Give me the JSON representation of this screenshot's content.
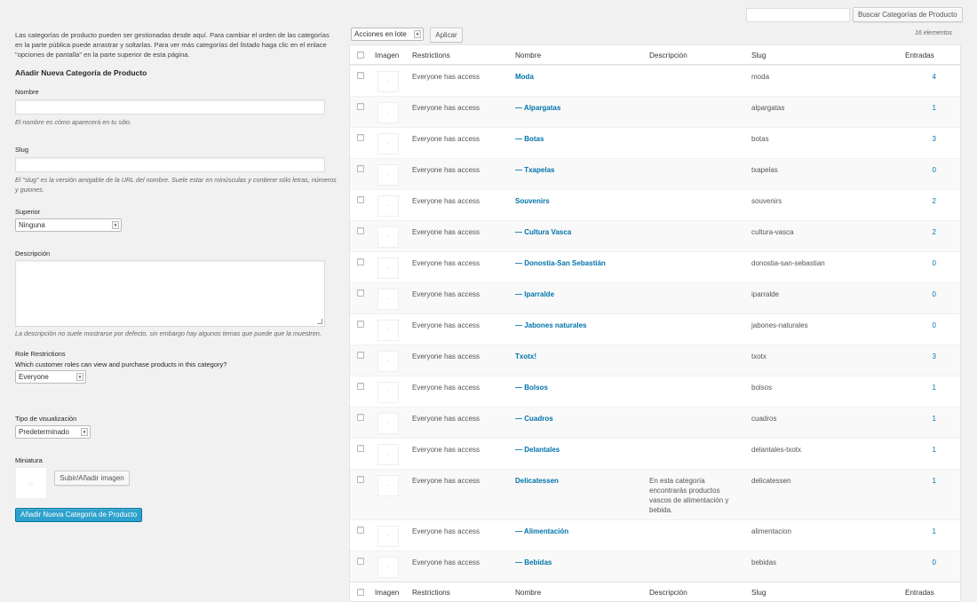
{
  "search": {
    "button_label": "Buscar Categorías de Producto",
    "value": ""
  },
  "left": {
    "intro": "Las categorías de producto pueden ser gestionadas desde aquí. Para cambiar el orden de las categorías en la parte pública puede arrastrar y soltarlas. Para ver más categorías del listado haga clic en el enlace \"opciones de pantalla\" en la parte superior de esta página.",
    "form_title": "Añadir Nueva Categoría de Producto",
    "name_label": "Nombre",
    "name_help": "El nombre es cómo aparecerá en tu sitio.",
    "slug_label": "Slug",
    "slug_help": "El \"slug\" es la versión amigable de la URL del nombre. Suele estar en minúsculas y contiene sólo letras, números y guiones.",
    "parent_label": "Superior",
    "parent_value": "Ninguna",
    "desc_label": "Descripción",
    "desc_help": "La descripción no suele mostrarse por defecto, sin embargo hay algunos temas que puede que la muestren.",
    "role_label": "Role Restrictions",
    "role_help": "Which customer roles can view and purchase products in this category?",
    "role_value": "Everyone",
    "display_label": "Tipo de visualización",
    "display_value": "Predeterminado",
    "thumb_label": "Miniatura",
    "thumb_button": "Subir/Añadir imagen",
    "submit_label": "Añadir Nueva Categoría de Producto"
  },
  "bulk": {
    "select_value": "Acciones en lote",
    "apply_label": "Aplicar"
  },
  "count_text": "16 elementos",
  "columns": {
    "image": "Imagen",
    "restrictions": "Restrictions",
    "name": "Nombre",
    "description": "Descripción",
    "slug": "Slug",
    "count": "Entradas"
  },
  "rows": [
    {
      "restrictions": "Everyone has access",
      "name": "Moda",
      "description": "",
      "slug": "moda",
      "count": "4"
    },
    {
      "restrictions": "Everyone has access",
      "name": "— Alpargatas",
      "description": "",
      "slug": "alpargatas",
      "count": "1"
    },
    {
      "restrictions": "Everyone has access",
      "name": "— Botas",
      "description": "",
      "slug": "botas",
      "count": "3"
    },
    {
      "restrictions": "Everyone has access",
      "name": "— Txapelas",
      "description": "",
      "slug": "txapelas",
      "count": "0"
    },
    {
      "restrictions": "Everyone has access",
      "name": "Souvenirs",
      "description": "",
      "slug": "souvenirs",
      "count": "2"
    },
    {
      "restrictions": "Everyone has access",
      "name": "— Cultura Vasca",
      "description": "",
      "slug": "cultura-vasca",
      "count": "2"
    },
    {
      "restrictions": "Everyone has access",
      "name": "— Donostia-San Sebastián",
      "description": "",
      "slug": "donostia-san-sebastian",
      "count": "0"
    },
    {
      "restrictions": "Everyone has access",
      "name": "— Iparralde",
      "description": "",
      "slug": "iparralde",
      "count": "0"
    },
    {
      "restrictions": "Everyone has access",
      "name": "— Jabones naturales",
      "description": "",
      "slug": "jabones-naturales",
      "count": "0"
    },
    {
      "restrictions": "Everyone has access",
      "name": "Txotx!",
      "description": "",
      "slug": "txotx",
      "count": "3"
    },
    {
      "restrictions": "Everyone has access",
      "name": "— Bolsos",
      "description": "",
      "slug": "bolsos",
      "count": "1"
    },
    {
      "restrictions": "Everyone has access",
      "name": "— Cuadros",
      "description": "",
      "slug": "cuadros",
      "count": "1"
    },
    {
      "restrictions": "Everyone has access",
      "name": "— Delantales",
      "description": "",
      "slug": "delantales-txotx",
      "count": "1"
    },
    {
      "restrictions": "Everyone has access",
      "name": "Delicatessen",
      "description": "En esta categoría encontrarás productos vascos de alimentación y bebida.",
      "slug": "delicatessen",
      "count": "1"
    },
    {
      "restrictions": "Everyone has access",
      "name": "— Alimentación",
      "description": "",
      "slug": "alimentacion",
      "count": "1"
    },
    {
      "restrictions": "Everyone has access",
      "name": "— Bebidas",
      "description": "",
      "slug": "bebidas",
      "count": "0"
    }
  ]
}
